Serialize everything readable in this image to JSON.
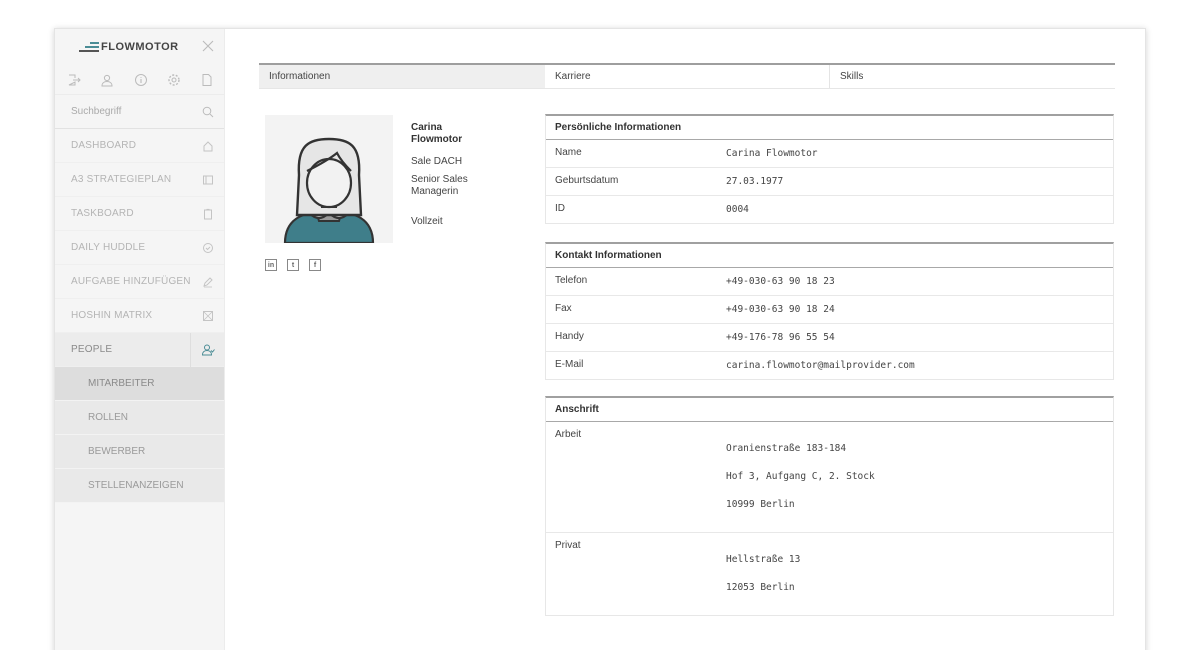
{
  "app": {
    "logo_text": "FLOWMOTOR"
  },
  "sidebar": {
    "search_placeholder": "Suchbegriff",
    "nav": [
      {
        "label": "DASHBOARD",
        "icon": "home-icon"
      },
      {
        "label": "A3 STRATEGIEPLAN",
        "icon": "book-icon"
      },
      {
        "label": "TASKBOARD",
        "icon": "clipboard-icon"
      },
      {
        "label": "DAILY HUDDLE",
        "icon": "check-circle-icon"
      },
      {
        "label": "AUFGABE HINZUFÜGEN",
        "icon": "pencil-icon"
      },
      {
        "label": "HOSHIN MATRIX",
        "icon": "matrix-icon"
      },
      {
        "label": "PEOPLE",
        "icon": "people-icon"
      }
    ],
    "sub_nav": [
      "MITARBEITER",
      "ROLLEN",
      "BEWERBER",
      "STELLENANZEIGEN"
    ]
  },
  "tabs": [
    "Informationen",
    "Karriere",
    "Skills"
  ],
  "person": {
    "name": "Carina Flowmotor",
    "region": "Sale DACH",
    "role": "Senior Sales Managerin",
    "employment": "Vollzeit",
    "socials": [
      "in",
      "t",
      "f"
    ]
  },
  "sections": {
    "personal": {
      "title": "Persönliche Informationen",
      "rows": [
        {
          "label": "Name",
          "value": "Carina Flowmotor"
        },
        {
          "label": "Geburtsdatum",
          "value": "27.03.1977"
        },
        {
          "label": "ID",
          "value": "0004"
        }
      ]
    },
    "contact": {
      "title": "Kontakt Informationen",
      "rows": [
        {
          "label": "Telefon",
          "value": "+49-030-63 90 18 23"
        },
        {
          "label": "Fax",
          "value": "+49-030-63 90 18 24"
        },
        {
          "label": "Handy",
          "value": "+49-176-78 96 55 54"
        },
        {
          "label": "E-Mail",
          "value": "carina.flowmotor@mailprovider.com"
        }
      ]
    },
    "address": {
      "title": "Anschrift",
      "rows": [
        {
          "label": "Arbeit",
          "lines": [
            "Oranienstraße 183-184",
            "Hof 3, Aufgang C, 2. Stock",
            "10999 Berlin"
          ]
        },
        {
          "label": "Privat",
          "lines": [
            "Hellstraße 13",
            "12053 Berlin"
          ]
        }
      ]
    }
  },
  "colors": {
    "accent": "#4a8c95",
    "avatar_shirt": "#3f7e8a"
  }
}
